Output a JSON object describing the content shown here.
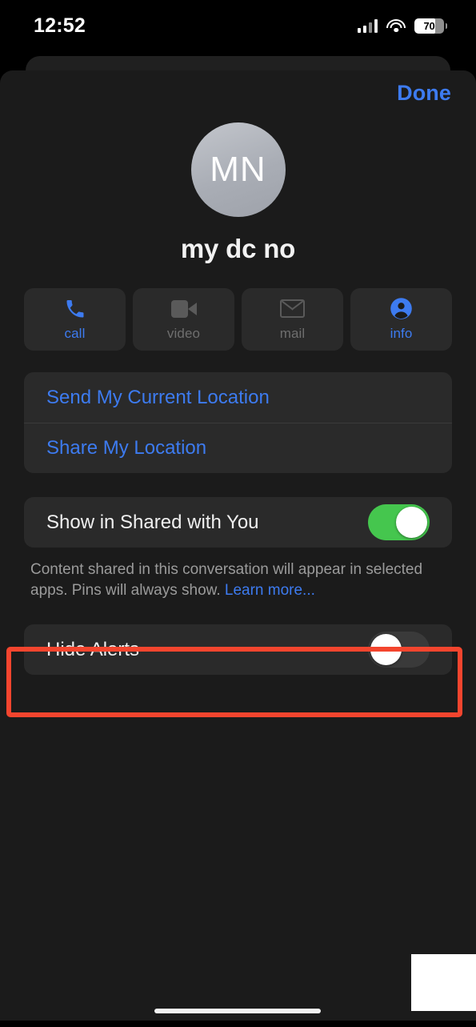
{
  "status_bar": {
    "time": "12:52",
    "signal_icon": "cellular-signal-icon",
    "wifi_icon": "wifi-icon",
    "battery_percent": "70",
    "battery_level": 70
  },
  "sheet": {
    "done_label": "Done"
  },
  "contact": {
    "initials": "MN",
    "name": "my dc no"
  },
  "actions": [
    {
      "id": "call",
      "label": "call",
      "icon": "phone-icon",
      "enabled": true
    },
    {
      "id": "video",
      "label": "video",
      "icon": "video-camera-icon",
      "enabled": false
    },
    {
      "id": "mail",
      "label": "mail",
      "icon": "envelope-icon",
      "enabled": false
    },
    {
      "id": "info",
      "label": "info",
      "icon": "person-circle-icon",
      "enabled": true
    }
  ],
  "location_rows": [
    {
      "id": "send-current-location",
      "label": "Send My Current Location"
    },
    {
      "id": "share-my-location",
      "label": "Share My Location"
    }
  ],
  "shared_with_you": {
    "label": "Show in Shared with You",
    "enabled": true,
    "footnote_text": "Content shared in this conversation will appear in selected apps. Pins will always show. ",
    "footnote_link": "Learn more..."
  },
  "hide_alerts": {
    "label": "Hide Alerts",
    "enabled": false
  },
  "colors": {
    "accent_blue": "#3d7bf0",
    "toggle_on_green": "#45c64e",
    "annotation_red": "#f4452e",
    "sheet_background": "#1b1b1b",
    "card_background": "#2a2a2a"
  }
}
